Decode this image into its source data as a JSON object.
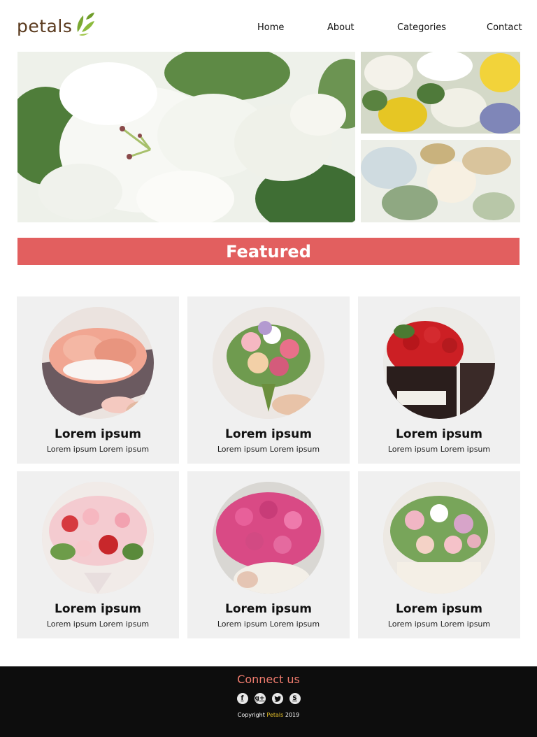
{
  "header": {
    "logo_text": "petals",
    "nav": [
      {
        "label": "Home"
      },
      {
        "label": "About"
      },
      {
        "label": "Categories"
      },
      {
        "label": "Contact"
      }
    ]
  },
  "featured": {
    "title": "Featured"
  },
  "cards": [
    {
      "title": "Lorem ipsum",
      "desc": "Lorem ipsum Lorem ipsum"
    },
    {
      "title": "Lorem ipsum",
      "desc": "Lorem ipsum Lorem ipsum"
    },
    {
      "title": "Lorem ipsum",
      "desc": "Lorem ipsum Lorem ipsum"
    },
    {
      "title": "Lorem ipsum",
      "desc": "Lorem ipsum Lorem ipsum"
    },
    {
      "title": "Lorem ipsum",
      "desc": "Lorem ipsum Lorem ipsum"
    },
    {
      "title": "Lorem ipsum",
      "desc": "Lorem ipsum Lorem ipsum"
    }
  ],
  "footer": {
    "connect_label": "Connect us",
    "social_icons": [
      "facebook-icon",
      "google-plus-icon",
      "twitter-icon",
      "skype-icon"
    ],
    "copyright_prefix": "Copyright",
    "copyright_brand": "Petals",
    "copyright_year": "2019"
  },
  "colors": {
    "accent": "#e25f5f",
    "connect": "#f07c6e",
    "brand_footer": "#e6c12a",
    "logo": "#5a3a1e",
    "footer_bg": "#0d0d0d",
    "card_bg": "#f0f0f0"
  }
}
